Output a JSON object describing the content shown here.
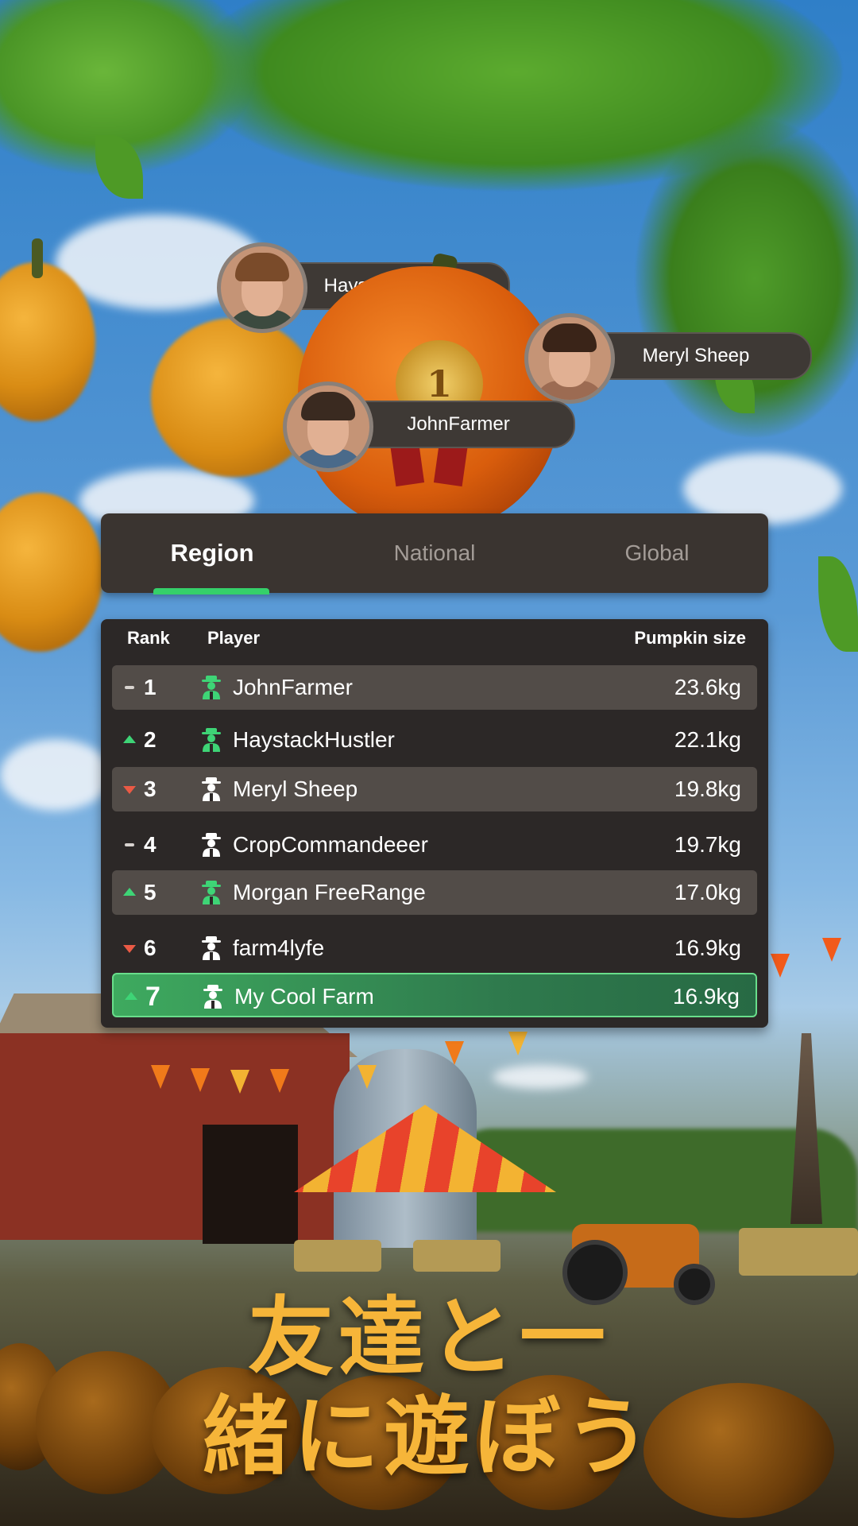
{
  "podium": {
    "first": {
      "name": "JohnFarmer",
      "medal_text": "1"
    },
    "second": {
      "name": "HaystackHustler"
    },
    "third": {
      "name": "Meryl Sheep"
    }
  },
  "tabs": [
    {
      "label": "Region",
      "active": true
    },
    {
      "label": "National",
      "active": false
    },
    {
      "label": "Global",
      "active": false
    }
  ],
  "leaderboard": {
    "headers": {
      "rank": "Rank",
      "player": "Player",
      "size": "Pumpkin size"
    },
    "rows": [
      {
        "trend": "same",
        "rank": "1",
        "player": "JohnFarmer",
        "size": "23.6kg",
        "icon": "farmer-icon-green"
      },
      {
        "trend": "up",
        "rank": "2",
        "player": "HaystackHustler",
        "size": "22.1kg",
        "icon": "farmer-icon-green"
      },
      {
        "trend": "down",
        "rank": "3",
        "player": "Meryl Sheep",
        "size": "19.8kg",
        "icon": "farmer-icon-white"
      },
      {
        "trend": "same",
        "rank": "4",
        "player": "CropCommandeeer",
        "size": "19.7kg",
        "icon": "farmer-icon-white"
      },
      {
        "trend": "up",
        "rank": "5",
        "player": "Morgan FreeRange",
        "size": "17.0kg",
        "icon": "farmer-icon-green"
      },
      {
        "trend": "down",
        "rank": "6",
        "player": "farm4lyfe",
        "size": "16.9kg",
        "icon": "farmer-icon-white"
      },
      {
        "trend": "up",
        "rank": "7",
        "player": "My Cool Farm",
        "size": "16.9kg",
        "icon": "farmer-icon-white"
      }
    ]
  },
  "headline": {
    "line1": "友達と一",
    "line2": "緒に遊ぼう"
  },
  "colors": {
    "accent_green": "#35d06a",
    "trend_up": "#3ed476",
    "trend_down": "#ea5a45",
    "headline": "#f6b539"
  }
}
